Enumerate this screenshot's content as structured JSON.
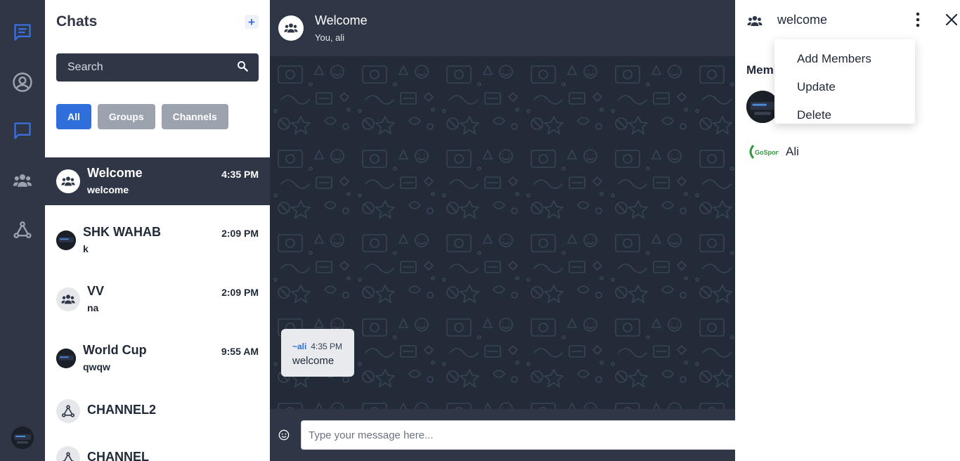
{
  "sidebar": {
    "items": [
      {
        "icon": "chat-list-icon",
        "color": "#3b6fe0"
      },
      {
        "icon": "profile-icon",
        "color": "#9ca3af"
      },
      {
        "icon": "chat-icon",
        "color": "#3b6fe0"
      },
      {
        "icon": "groups-icon",
        "color": "#9ca3af"
      },
      {
        "icon": "channels-icon",
        "color": "#9ca3af"
      }
    ]
  },
  "chat_list": {
    "title": "Chats",
    "add_label": "+",
    "search_placeholder": "Search",
    "filters": [
      {
        "label": "All",
        "active": true
      },
      {
        "label": "Groups",
        "active": false
      },
      {
        "label": "Channels",
        "active": false
      }
    ],
    "chats": [
      {
        "name": "Welcome",
        "last": "welcome",
        "time": "4:35 PM",
        "type": "group",
        "active": true
      },
      {
        "name": "SHK WAHAB",
        "last": "k",
        "time": "2:09 PM",
        "type": "user",
        "active": false
      },
      {
        "name": "VV",
        "last": "na",
        "time": "2:09 PM",
        "type": "group",
        "active": false
      },
      {
        "name": "World Cup",
        "last": "qwqw",
        "time": "9:55 AM",
        "type": "user",
        "active": false
      },
      {
        "name": "CHANNEL2",
        "last": "",
        "time": "",
        "type": "channel",
        "active": false
      },
      {
        "name": "CHANNEL",
        "last": "",
        "time": "",
        "type": "channel",
        "active": false
      }
    ]
  },
  "conversation": {
    "title": "Welcome",
    "subtitle": "You, ali",
    "messages": [
      {
        "from": "~ali",
        "time": "4:35 PM",
        "text": "welcome"
      }
    ],
    "composer_placeholder": "Type your message here..."
  },
  "info_panel": {
    "name": "welcome",
    "members_title": "Members",
    "members": [
      {
        "name": ""
      },
      {
        "name": "Ali"
      }
    ],
    "menu": [
      "Add Members",
      "Update",
      "Delete"
    ]
  },
  "colors": {
    "accent": "#2f6fdc",
    "dark": "#2f3747",
    "wallpaper": "#232a38"
  }
}
